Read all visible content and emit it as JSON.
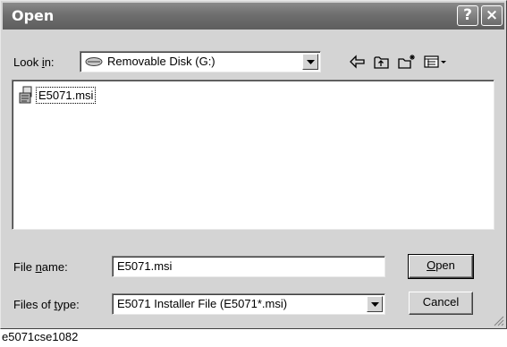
{
  "window": {
    "title": "Open",
    "help_glyph": "?",
    "close_glyph": "×"
  },
  "look_in": {
    "label_pre": "Look ",
    "label_key": "i",
    "label_post": "n:",
    "value": "Removable Disk (G:)",
    "icon": "removable-disk-icon"
  },
  "toolbar": {
    "icons": [
      "back-arrow-icon",
      "up-folder-icon",
      "new-folder-icon",
      "view-menu-icon"
    ]
  },
  "files": [
    {
      "name": "E5071.msi",
      "icon": "msi-installer-icon"
    }
  ],
  "file_name": {
    "label_pre": "File ",
    "label_key": "n",
    "label_post": "ame:",
    "value": "E5071.msi"
  },
  "file_type": {
    "label_pre": "Files of ",
    "label_key": "t",
    "label_post": "ype:",
    "value": "E5071 Installer File (E5071*.msi)"
  },
  "buttons": {
    "open_key": "O",
    "open_rest": "pen",
    "cancel": "Cancel"
  },
  "caption": "e5071cse1082"
}
